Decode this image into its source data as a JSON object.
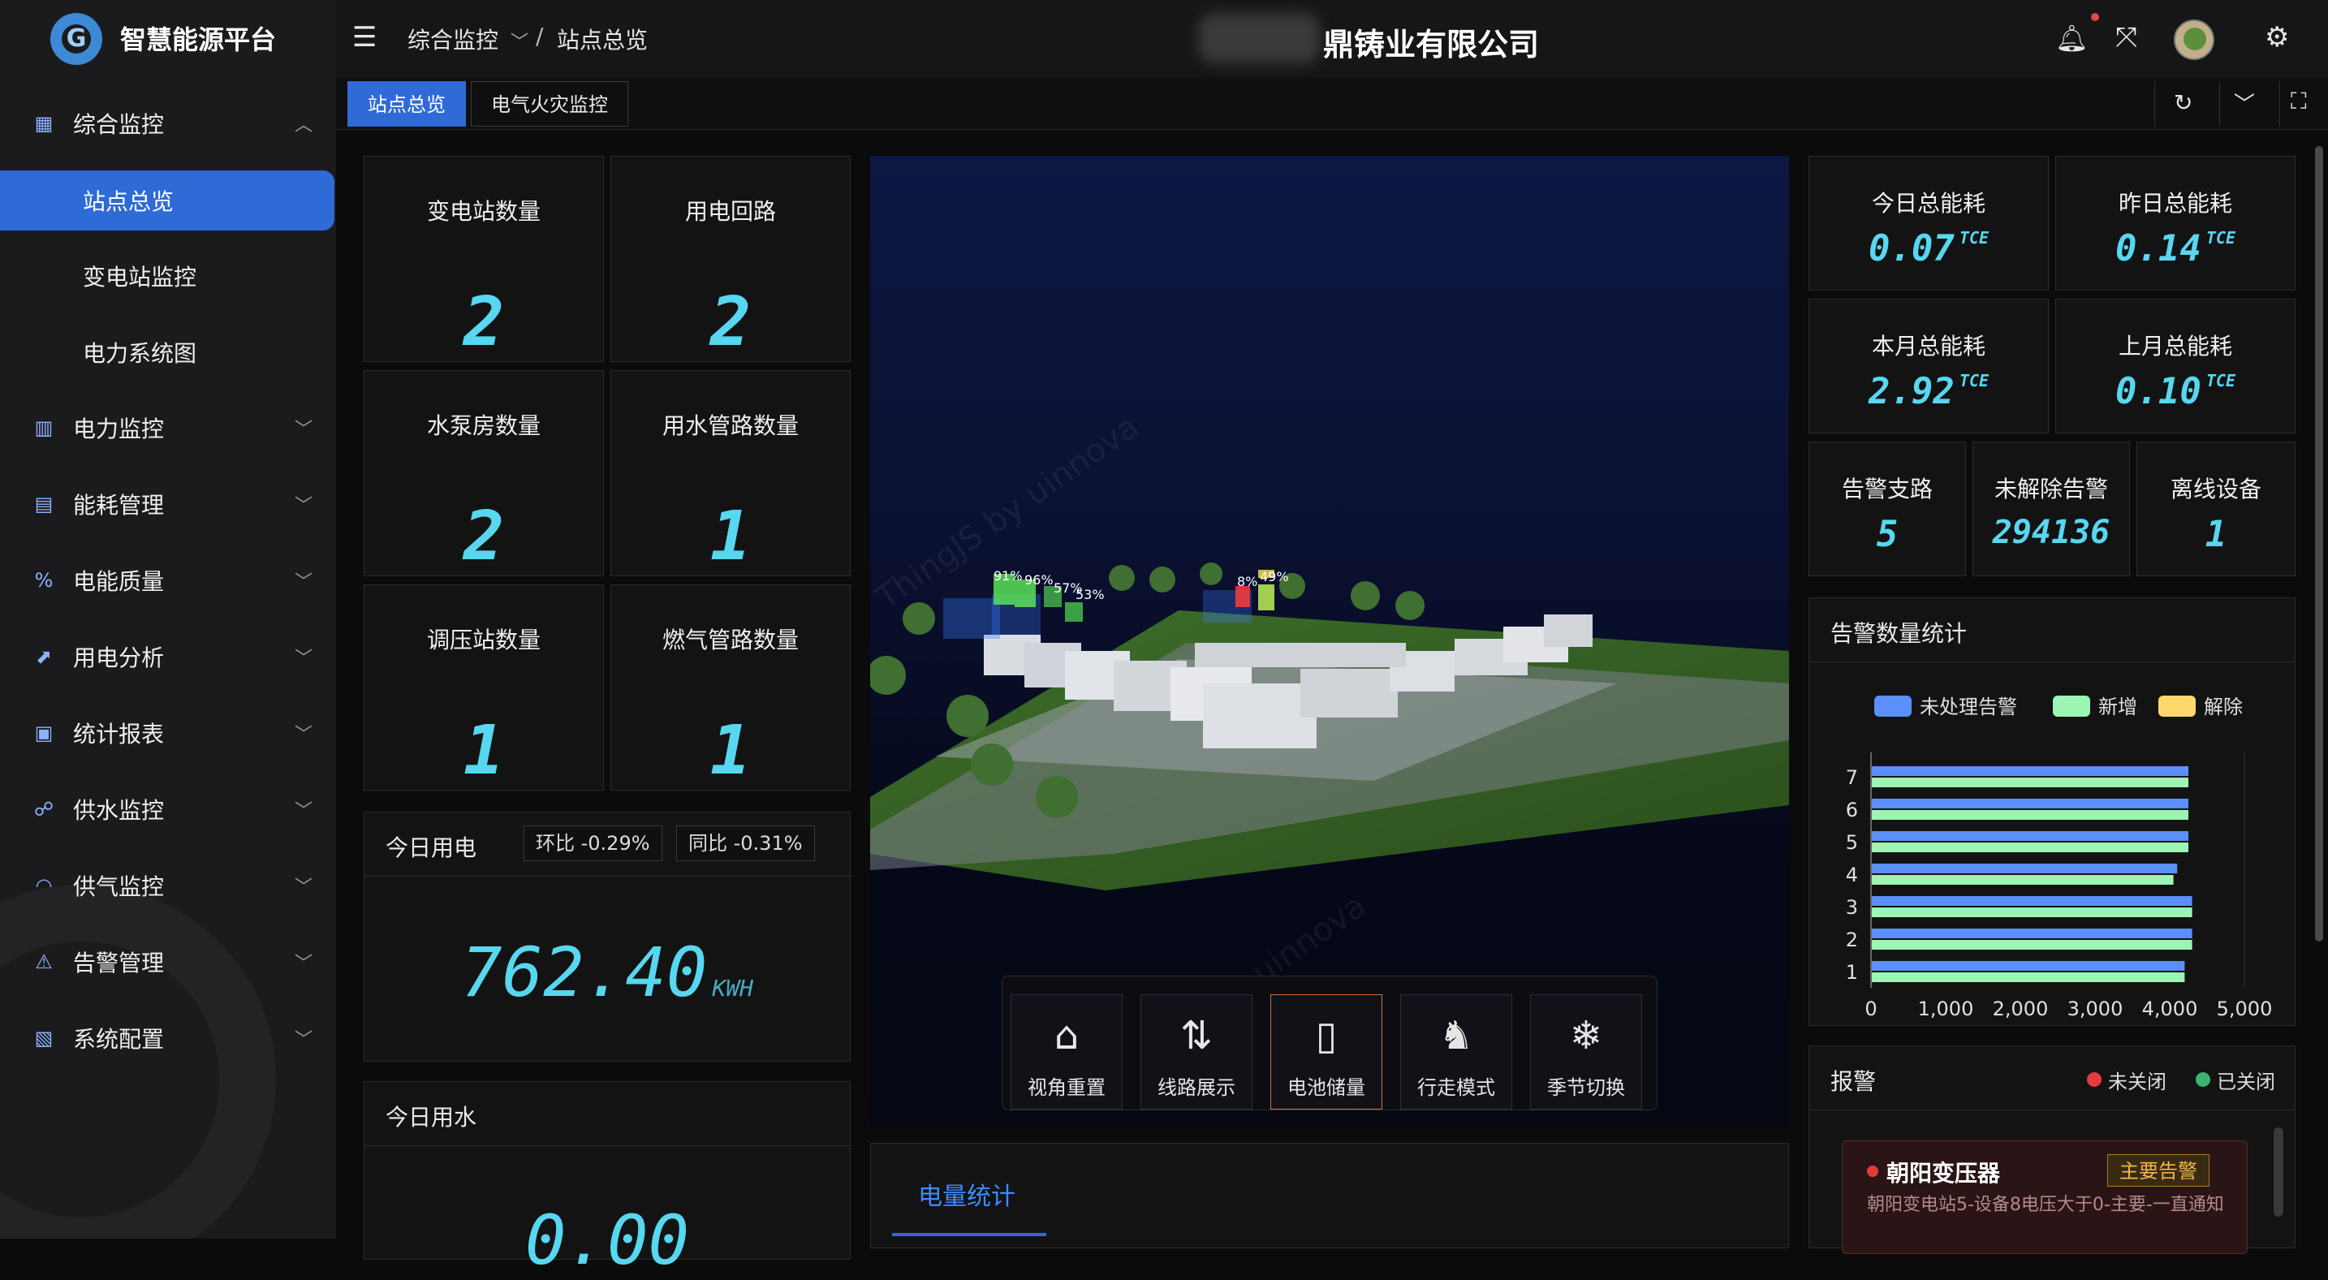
{
  "app": {
    "title": "智慧能源平台",
    "logo_letter": "G"
  },
  "sidebar": {
    "items": [
      {
        "label": "综合监控",
        "icon": "grid-icon",
        "glyph": "▦",
        "expanded": true
      },
      {
        "label": "电力监控",
        "icon": "bar-chart-icon",
        "glyph": "▥"
      },
      {
        "label": "能耗管理",
        "icon": "building-icon",
        "glyph": "▤"
      },
      {
        "label": "电能质量",
        "icon": "percent-icon",
        "glyph": "%"
      },
      {
        "label": "用电分析",
        "icon": "line-chart-icon",
        "glyph": "⬈"
      },
      {
        "label": "统计报表",
        "icon": "report-icon",
        "glyph": "▣"
      },
      {
        "label": "供水监控",
        "icon": "water-icon",
        "glyph": "☍"
      },
      {
        "label": "供气监控",
        "icon": "wifi-icon",
        "glyph": "◠"
      },
      {
        "label": "告警管理",
        "icon": "warning-icon",
        "glyph": "⚠"
      },
      {
        "label": "系统配置",
        "icon": "config-icon",
        "glyph": "▧"
      }
    ],
    "sub_items": [
      {
        "label": "站点总览",
        "active": true
      },
      {
        "label": "变电站监控"
      },
      {
        "label": "电力系统图"
      }
    ]
  },
  "header": {
    "breadcrumb": [
      "综合监控",
      "站点总览"
    ],
    "breadcrumb_sep": "/",
    "company": "鼎铸业有限公司"
  },
  "tabs": [
    {
      "label": "站点总览",
      "active": true
    },
    {
      "label": "电气火灾监控"
    }
  ],
  "stats": [
    {
      "label": "变电站数量",
      "value": "2"
    },
    {
      "label": "用电回路",
      "value": "2"
    },
    {
      "label": "水泵房数量",
      "value": "2"
    },
    {
      "label": "用水管路数量",
      "value": "1"
    },
    {
      "label": "调压站数量",
      "value": "1"
    },
    {
      "label": "燃气管路数量",
      "value": "1"
    }
  ],
  "today_power": {
    "title": "今日用电",
    "hb": "环比 -0.29%",
    "tb": "同比 -0.31%",
    "value": "762.40",
    "unit": "KWH"
  },
  "today_water": {
    "title": "今日用水",
    "value": "0.00"
  },
  "scene": {
    "percent_labels": [
      "91%",
      "96%",
      "57%",
      "53%",
      "8%",
      "49%"
    ],
    "watermark": "ThingJS by uinnova",
    "controls": [
      {
        "label": "视角重置",
        "icon": "home-icon",
        "glyph": "⌂"
      },
      {
        "label": "线路展示",
        "icon": "route-icon",
        "glyph": "⇅"
      },
      {
        "label": "电池储量",
        "icon": "battery-icon",
        "glyph": "▯",
        "active": true
      },
      {
        "label": "行走模式",
        "icon": "footprint-icon",
        "glyph": "♞"
      },
      {
        "label": "季节切换",
        "icon": "snowflake-icon",
        "glyph": "❄"
      }
    ]
  },
  "bottom_tab": {
    "label": "电量统计"
  },
  "energy": [
    {
      "label": "今日总能耗",
      "value": "0.07",
      "unit": "TCE"
    },
    {
      "label": "昨日总能耗",
      "value": "0.14",
      "unit": "TCE"
    },
    {
      "label": "本月总能耗",
      "value": "2.92",
      "unit": "TCE"
    },
    {
      "label": "上月总能耗",
      "value": "0.10",
      "unit": "TCE"
    }
  ],
  "alarm_stats": [
    {
      "label": "告警支路",
      "value": "5"
    },
    {
      "label": "未解除告警",
      "value": "294136"
    },
    {
      "label": "离线设备",
      "value": "1"
    }
  ],
  "alarm_chart_title": "告警数量统计",
  "chart_data": {
    "type": "bar",
    "orientation": "horizontal",
    "categories": [
      "1",
      "2",
      "3",
      "4",
      "5",
      "6",
      "7"
    ],
    "series": [
      {
        "name": "未处理告警",
        "color": "#5b8ff9",
        "values": [
          4200,
          4300,
          4300,
          4100,
          4250,
          4250,
          4250
        ]
      },
      {
        "name": "新增",
        "color": "#9df5b3",
        "values": [
          4200,
          4300,
          4300,
          4050,
          4250,
          4250,
          4250
        ]
      },
      {
        "name": "解除",
        "color": "#ffd86b",
        "values": [
          0,
          0,
          0,
          0,
          0,
          0,
          0
        ]
      }
    ],
    "xticks": [
      "0",
      "1,000",
      "2,000",
      "3,000",
      "4,000",
      "5,000"
    ],
    "xlim": [
      0,
      5000
    ],
    "legend": "top-center"
  },
  "alarm_panel": {
    "title": "报警",
    "legend_open": "未关闭",
    "legend_closed": "已关闭",
    "item": {
      "name": "朝阳变压器",
      "level": "主要告警",
      "desc": "朝阳变电站5-设备8电压大于0-主要-一直通知"
    }
  }
}
